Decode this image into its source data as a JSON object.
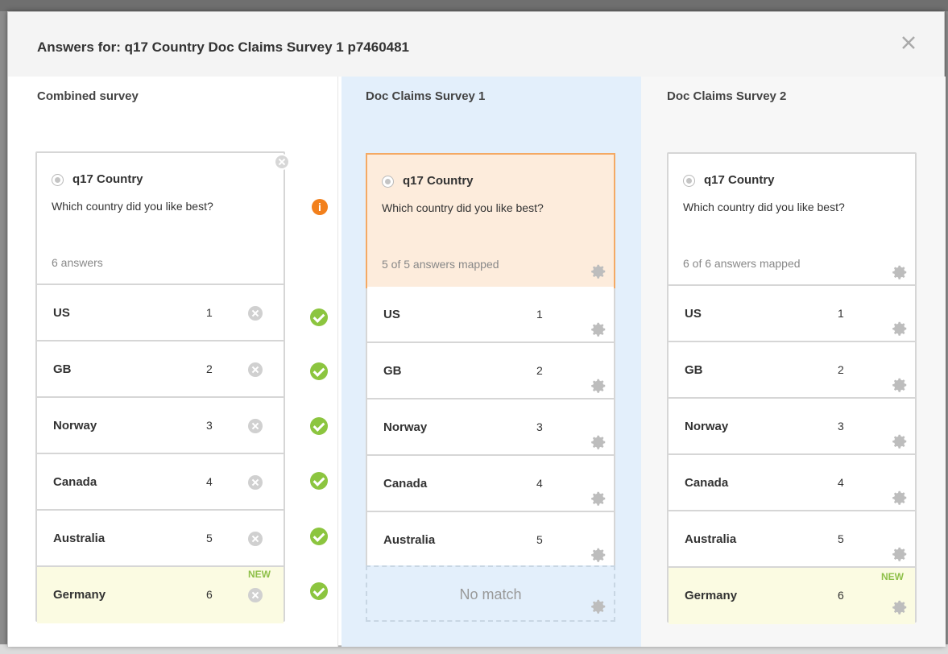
{
  "modal": {
    "title": "Answers for: q17 Country Doc Claims Survey 1 p7460481",
    "close_icon": "close-icon"
  },
  "columns": [
    {
      "header": "Combined survey",
      "question": {
        "code": "q17 Country",
        "text": "Which country did you like best?",
        "status": "6 answers"
      },
      "rows": [
        {
          "label": "US",
          "code": "1"
        },
        {
          "label": "GB",
          "code": "2"
        },
        {
          "label": "Norway",
          "code": "3"
        },
        {
          "label": "Canada",
          "code": "4"
        },
        {
          "label": "Australia",
          "code": "5"
        },
        {
          "label": "Germany",
          "code": "6",
          "badge": "NEW"
        }
      ]
    },
    {
      "header": "Doc Claims Survey 1",
      "question": {
        "code": "q17 Country",
        "text": "Which country did you like best?",
        "status": "5 of 5 answers mapped"
      },
      "rows": [
        {
          "label": "US",
          "code": "1"
        },
        {
          "label": "GB",
          "code": "2"
        },
        {
          "label": "Norway",
          "code": "3"
        },
        {
          "label": "Canada",
          "code": "4"
        },
        {
          "label": "Australia",
          "code": "5"
        }
      ],
      "no_match_label": "No match"
    },
    {
      "header": "Doc Claims Survey 2",
      "question": {
        "code": "q17 Country",
        "text": "Which country did you like best?",
        "status": "6 of 6 answers mapped"
      },
      "rows": [
        {
          "label": "US",
          "code": "1"
        },
        {
          "label": "GB",
          "code": "2"
        },
        {
          "label": "Norway",
          "code": "3"
        },
        {
          "label": "Canada",
          "code": "4"
        },
        {
          "label": "Australia",
          "code": "5"
        },
        {
          "label": "Germany",
          "code": "6",
          "badge": "NEW"
        }
      ]
    }
  ],
  "indicators": {
    "info_icon_glyph": "i"
  },
  "colors": {
    "accent_orange": "#f4a964",
    "selected_bg": "#fdecdc",
    "check_green": "#8cc53f",
    "info_orange": "#f2801c",
    "new_row_bg": "#fbfbe2",
    "highlight_column_bg": "#e3effb"
  }
}
